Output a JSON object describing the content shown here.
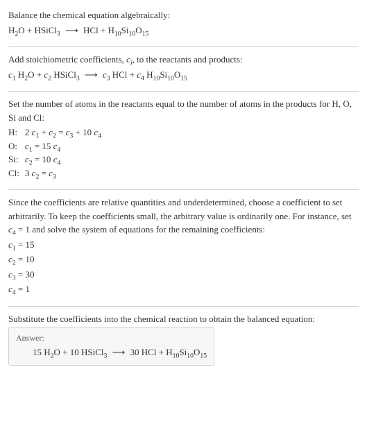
{
  "intro": {
    "line1": "Balance the chemical equation algebraically:",
    "eq_text": "H₂O + HSiCl₃  ⟶  HCl + H₁₀Si₁₀O₁₅"
  },
  "step1": {
    "text": "Add stoichiometric coefficients, cᵢ, to the reactants and products:",
    "eq_text": "c₁ H₂O + c₂ HSiCl₃  ⟶  c₃ HCl + c₄ H₁₀Si₁₀O₁₅"
  },
  "step2": {
    "text": "Set the number of atoms in the reactants equal to the number of atoms in the products for H, O, Si and Cl:",
    "rows": [
      {
        "el": "H:",
        "eq": "2 c₁ + c₂ = c₃ + 10 c₄"
      },
      {
        "el": "O:",
        "eq": "c₁ = 15 c₄"
      },
      {
        "el": "Si:",
        "eq": "c₂ = 10 c₄"
      },
      {
        "el": "Cl:",
        "eq": "3 c₂ = c₃"
      }
    ]
  },
  "step3": {
    "text": "Since the coefficients are relative quantities and underdetermined, choose a coefficient to set arbitrarily. To keep the coefficients small, the arbitrary value is ordinarily one. For instance, set c₄ = 1 and solve the system of equations for the remaining coefficients:",
    "sol": [
      "c₁ = 15",
      "c₂ = 10",
      "c₃ = 30",
      "c₄ = 1"
    ]
  },
  "step4": {
    "text": "Substitute the coefficients into the chemical reaction to obtain the balanced equation:"
  },
  "answer": {
    "label": "Answer:",
    "eq_text": "15 H₂O + 10 HSiCl₃  ⟶  30 HCl + H₁₀Si₁₀O₁₅"
  }
}
